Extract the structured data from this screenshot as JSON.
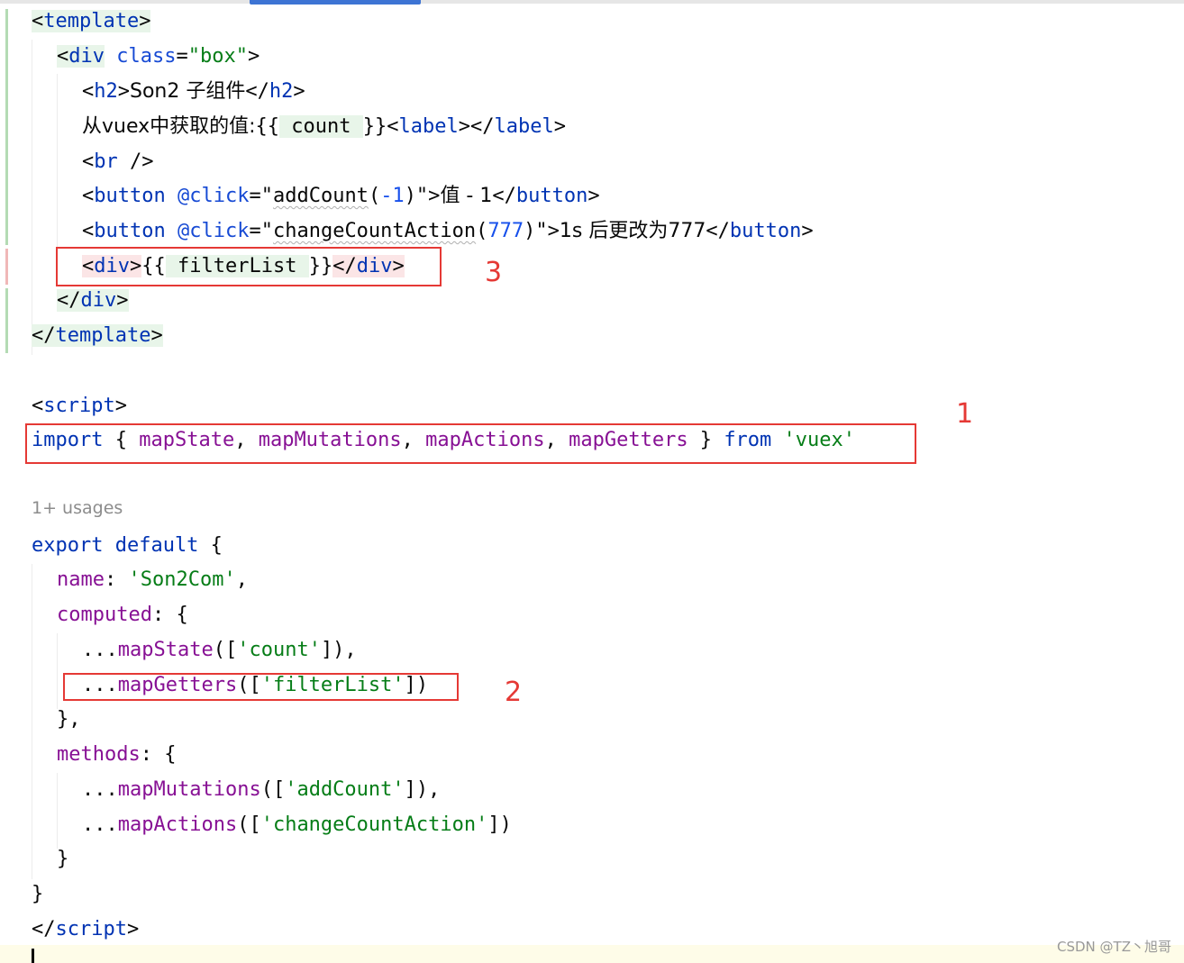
{
  "editor": {
    "usages_hint": "1+ usages",
    "watermark": "CSDN @TZ丶旭哥"
  },
  "template_block": {
    "open_template": "template",
    "div_tag": "div",
    "div_attr": "class",
    "div_attr_value": "\"box\"",
    "h2_tag": "h2",
    "h2_text": "Son2 子组件",
    "vuex_text_prefix": "从vuex中获取的值:",
    "count_expr": " count ",
    "label_tag": "label",
    "br_tag": "br",
    "button_tag": "button",
    "click_attr": "@click",
    "add_count_fn": "addCount",
    "add_count_arg": "-1",
    "button1_text": "值 - 1",
    "change_action_fn": "changeCountAction",
    "change_action_arg": "777",
    "button2_text": "1s 后更改为777",
    "filter_expr": " filterList ",
    "close_template": "template"
  },
  "script_block": {
    "script_tag": "script",
    "import_kw": "import",
    "import_names": [
      "mapState",
      "mapMutations",
      "mapActions",
      "mapGetters"
    ],
    "from_kw": "from",
    "module": "'vuex'",
    "export_kw": "export default",
    "name_key": "name",
    "name_value": "'Son2Com'",
    "computed_key": "computed",
    "map_state_fn": "mapState",
    "count_str": "'count'",
    "map_getters_fn": "mapGetters",
    "filter_list_str": "'filterList'",
    "methods_key": "methods",
    "map_mutations_fn": "mapMutations",
    "add_count_str": "'addCount'",
    "map_actions_fn": "mapActions",
    "change_action_str": "'changeCountAction'"
  },
  "annotations": [
    "1",
    "2",
    "3"
  ],
  "colors": {
    "tag": "#0033b3",
    "string": "#067d17",
    "property": "#871094",
    "number": "#1750eb",
    "annotation_red": "#e53935"
  }
}
